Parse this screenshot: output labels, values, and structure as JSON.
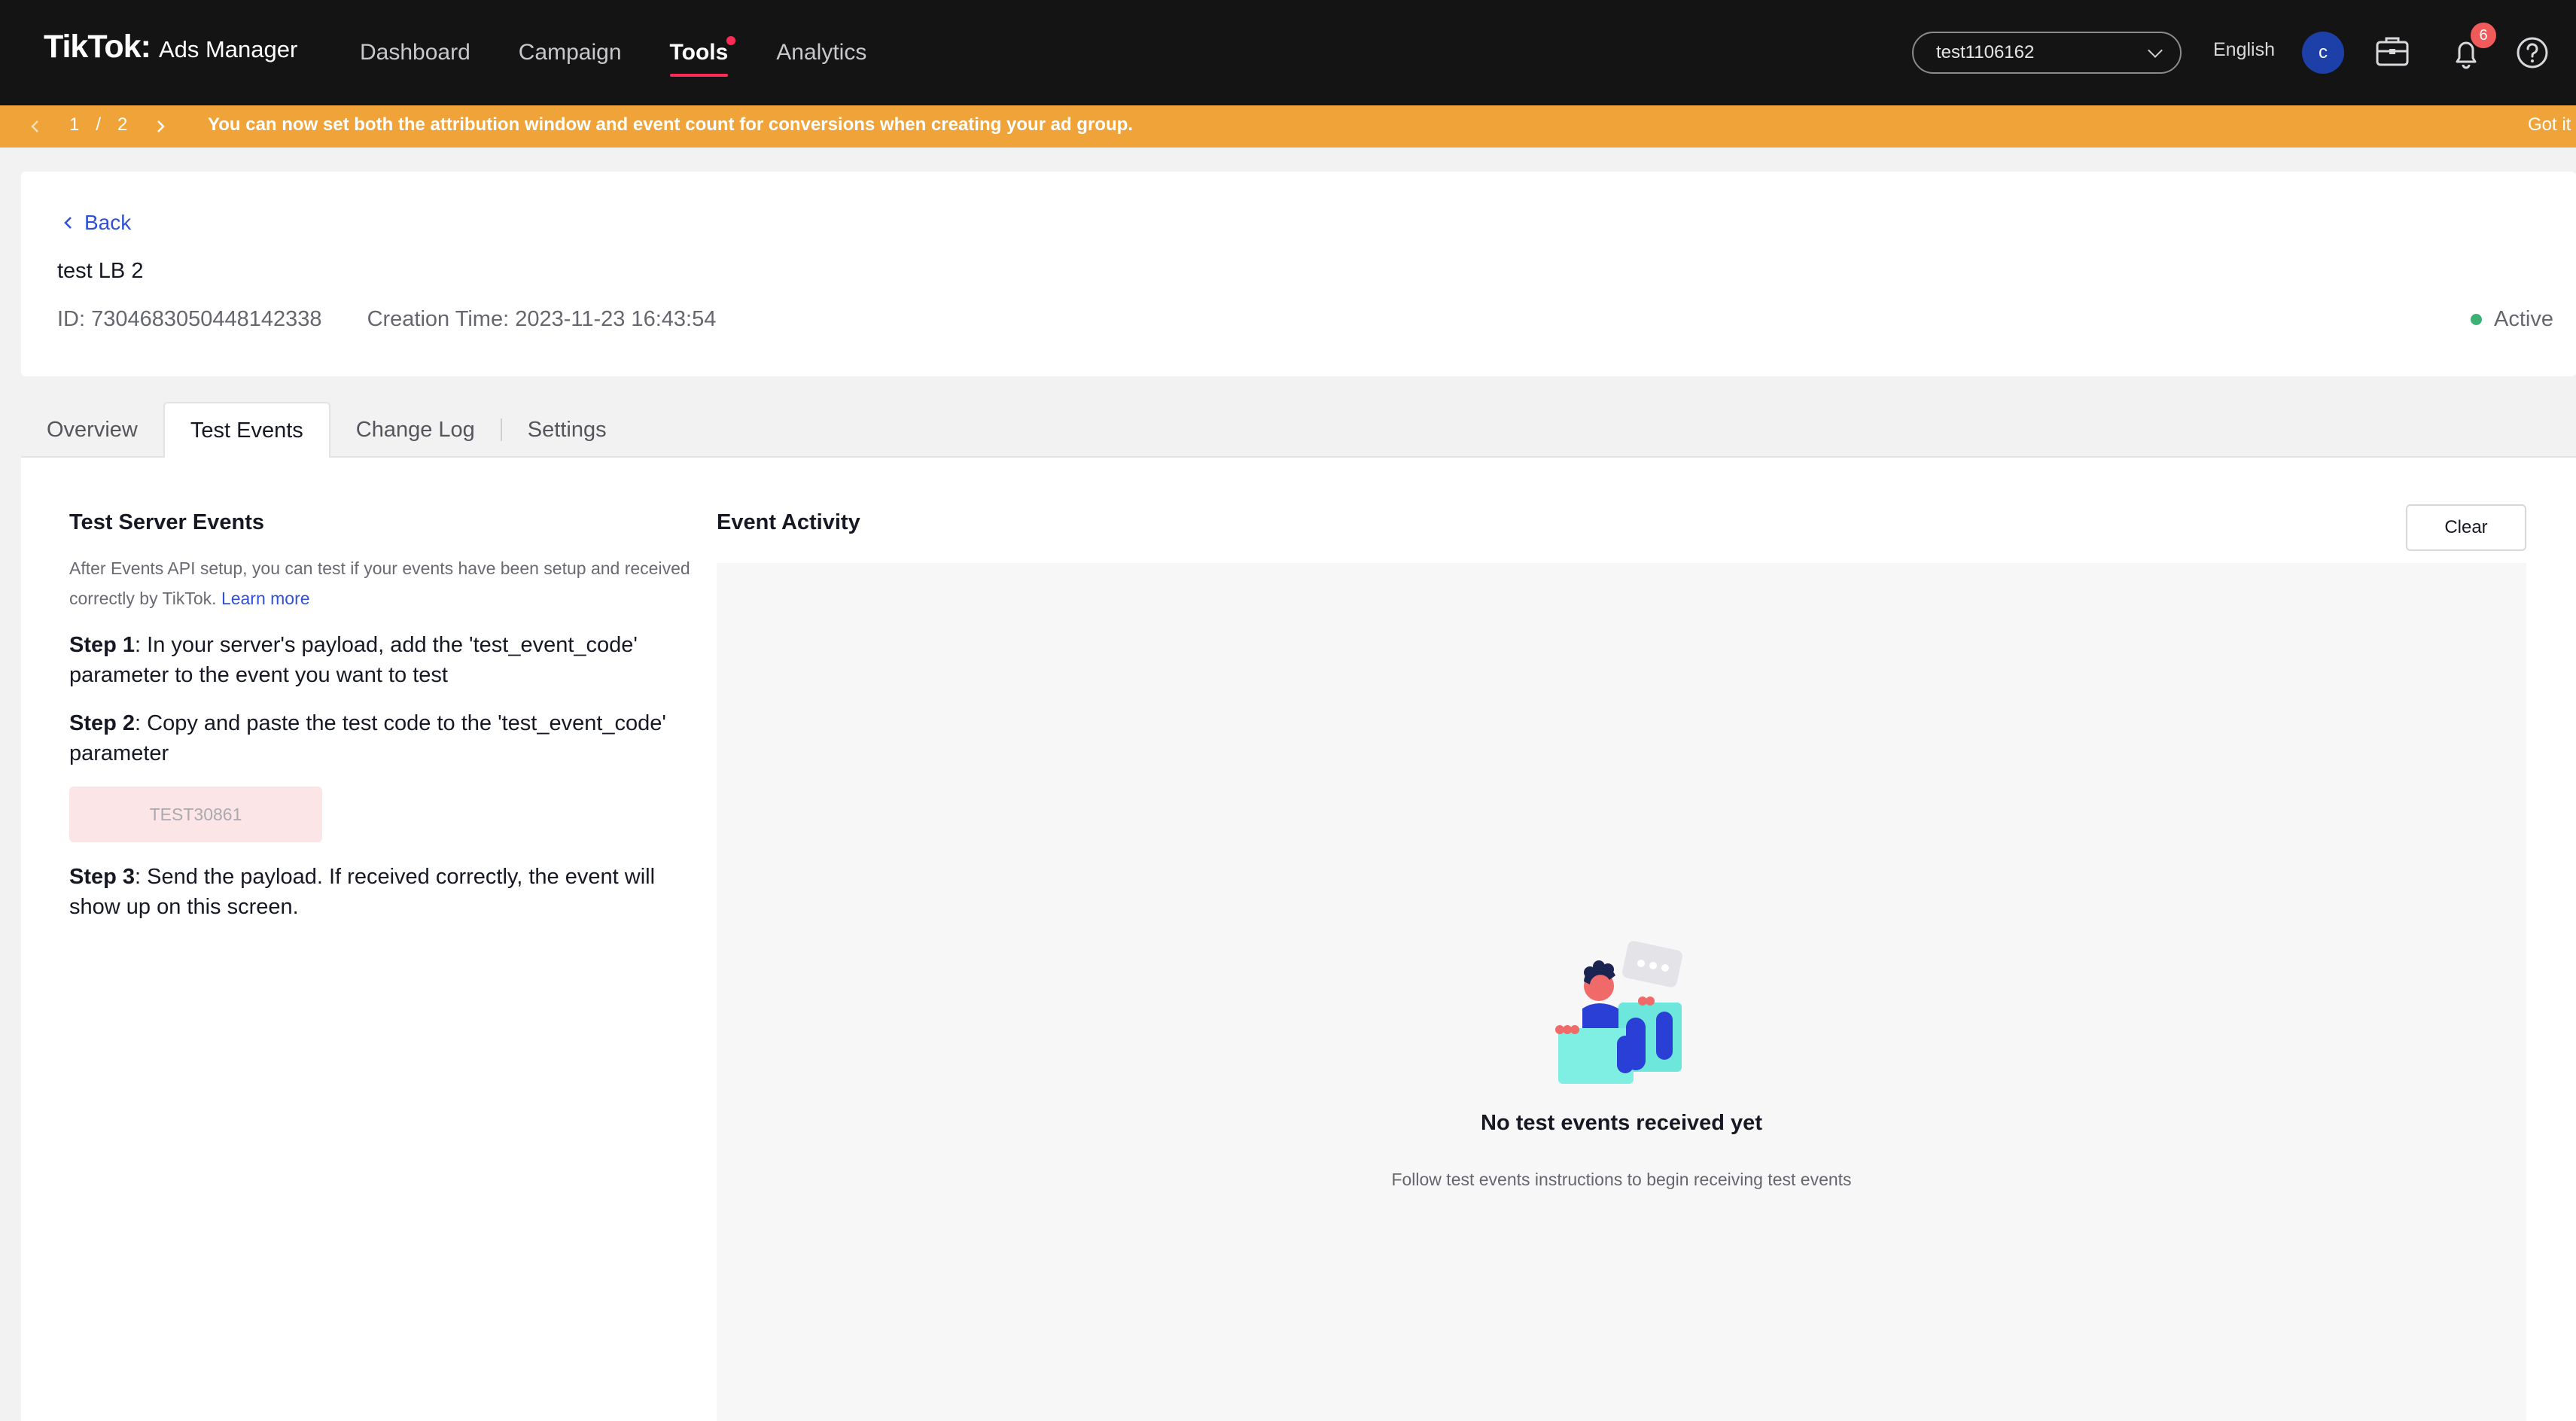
{
  "nav": {
    "brand_logo": "TikTok",
    "brand_colon": ":",
    "brand_sub": "Ads Manager",
    "items": [
      {
        "label": "Dashboard"
      },
      {
        "label": "Campaign"
      },
      {
        "label": "Tools"
      },
      {
        "label": "Analytics"
      }
    ],
    "account": "test1106162",
    "language": "English",
    "avatar_letter": "c",
    "notification_count": "6"
  },
  "announcement": {
    "page_current": "1",
    "page_sep": "/",
    "page_total": "2",
    "message": "You can now set both the attribution window and event count for conversions when creating your ad group.",
    "dismiss": "Got it"
  },
  "header": {
    "back_label": "Back",
    "title": "test LB 2",
    "id_text": "ID: 7304683050448142338",
    "creation_text": "Creation Time: 2023-11-23 16:43:54",
    "status": "Active"
  },
  "tabs": [
    {
      "label": "Overview"
    },
    {
      "label": "Test Events"
    },
    {
      "label": "Change Log"
    },
    {
      "label": "Settings"
    }
  ],
  "test_server": {
    "heading": "Test Server Events",
    "intro": "After Events API setup, you can test if your events have been setup and received correctly by TikTok.",
    "learn_more": "Learn more",
    "step1_label": "Step 1",
    "step1_text": ": In your server's payload, add the 'test_event_code' parameter to the event you want to test",
    "step2_label": "Step 2",
    "step2_text": ": Copy and paste the test code to the 'test_event_code' parameter",
    "test_code": "TEST30861",
    "step3_label": "Step 3",
    "step3_text": ": Send the payload. If received correctly, the event will show up on this screen."
  },
  "event_activity": {
    "heading": "Event Activity",
    "clear_label": "Clear",
    "empty_title": "No test events received yet",
    "empty_subtitle": "Follow test events instructions to begin receiving test events"
  },
  "colors": {
    "nav_bg": "#141414",
    "accent": "#fe2c55",
    "announcement_bg": "#f0a339",
    "link": "#3050d8",
    "status_active": "#3bb273"
  }
}
